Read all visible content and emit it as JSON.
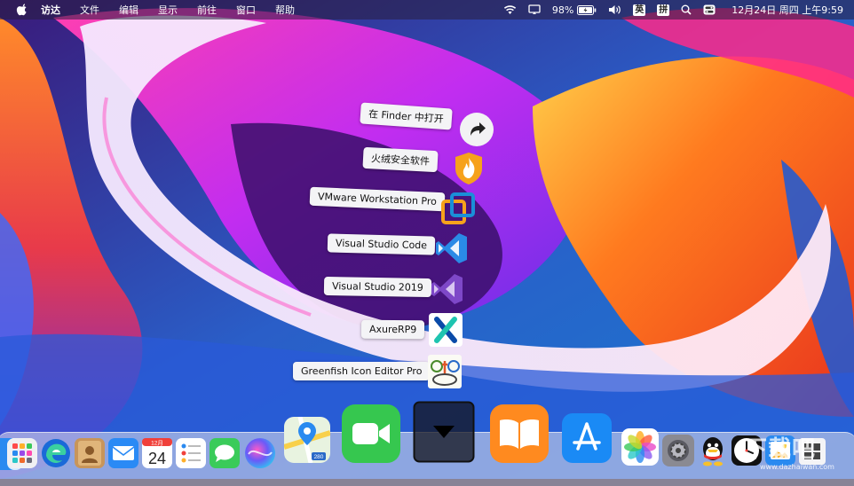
{
  "menubar": {
    "app_name": "访达",
    "menus": [
      "文件",
      "编辑",
      "显示",
      "前往",
      "窗口",
      "帮助"
    ],
    "battery": "98%",
    "input_en": "英",
    "input_pinyin": "拼",
    "datetime": "12月24日 周四 上午9:59"
  },
  "stack_items": [
    {
      "label": "在 Finder 中打开",
      "icon": "open-in-finder-arrow-icon"
    },
    {
      "label": "火绒安全软件",
      "icon": "huorong-security-icon"
    },
    {
      "label": "VMware Workstation Pro",
      "icon": "vmware-icon"
    },
    {
      "label": "Visual Studio Code",
      "icon": "vscode-icon"
    },
    {
      "label": "Visual Studio 2019",
      "icon": "visual-studio-icon"
    },
    {
      "label": "AxureRP9",
      "icon": "axure-icon"
    },
    {
      "label": "Greenfish Icon Editor Pro",
      "icon": "greenfish-icon"
    }
  ],
  "dock": {
    "calendar_month": "12月",
    "calendar_day": "24",
    "maps_badge": "280",
    "apps": [
      "finder-icon",
      "launchpad-icon",
      "edge-icon",
      "contacts-icon",
      "mail-icon",
      "calendar-icon",
      "reminders-icon",
      "messages-icon",
      "siri-icon",
      "maps-icon",
      "facetime-icon",
      "stack-folder-icon",
      "books-icon",
      "app-store-icon",
      "photos-icon",
      "system-preferences-icon",
      "qq-icon",
      "clock-icon",
      "preview-icon",
      "windows-icon"
    ]
  },
  "watermark": "www.dazhaiwan.com",
  "watermark_text": "下载吧"
}
